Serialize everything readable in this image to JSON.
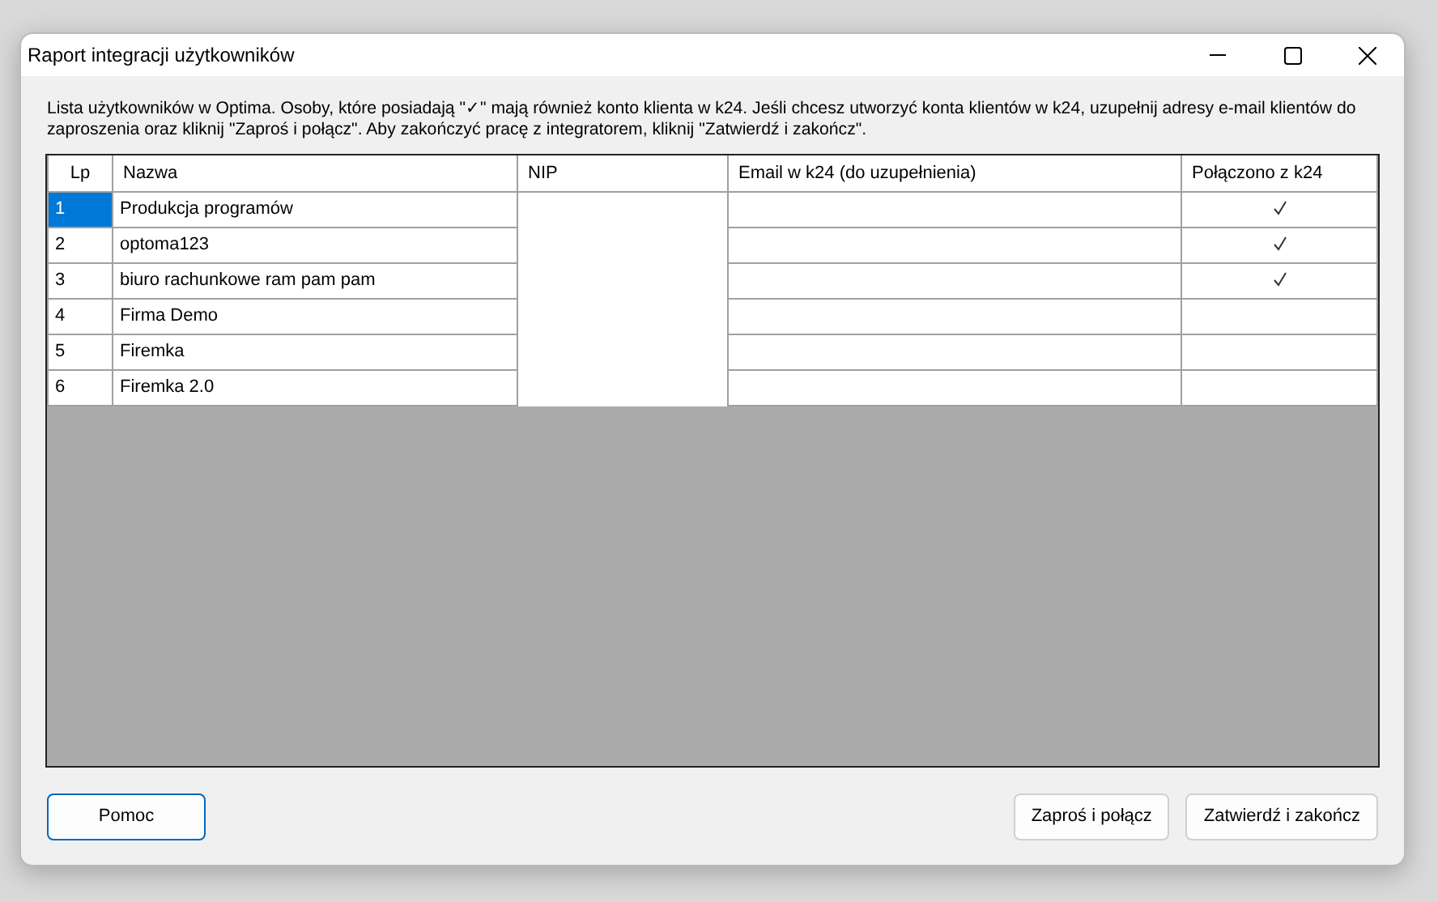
{
  "window": {
    "title": "Raport integracji użytkowników"
  },
  "instructions": "Lista użytkowników w Optima. Osoby, które posiadają \"✓\" mają również konto klienta w k24. Jeśli chcesz utworzyć konta klientów w k24, uzupełnij adresy e-mail klientów do zaproszenia oraz kliknij \"Zaproś i połącz\". Aby zakończyć pracę z integratorem, kliknij \"Zatwierdź i zakończ\".",
  "table": {
    "columns": [
      "Lp",
      "Nazwa",
      "NIP",
      "Email w k24 (do uzupełnienia)",
      "Połączono z k24"
    ],
    "rows": [
      {
        "lp": "1",
        "name": "Produkcja programów",
        "connected": true,
        "selected": true
      },
      {
        "lp": "2",
        "name": "optoma123",
        "connected": true,
        "selected": false
      },
      {
        "lp": "3",
        "name": "biuro rachunkowe ram pam pam",
        "connected": true,
        "selected": false
      },
      {
        "lp": "4",
        "name": "Firma Demo",
        "connected": false,
        "selected": false
      },
      {
        "lp": "5",
        "name": "Firemka",
        "connected": false,
        "selected": false
      },
      {
        "lp": "6",
        "name": "Firemka 2.0",
        "connected": false,
        "selected": false
      }
    ]
  },
  "buttons": {
    "help": "Pomoc",
    "invite": "Zaproś i połącz",
    "confirm": "Zatwierdź i zakończ"
  }
}
